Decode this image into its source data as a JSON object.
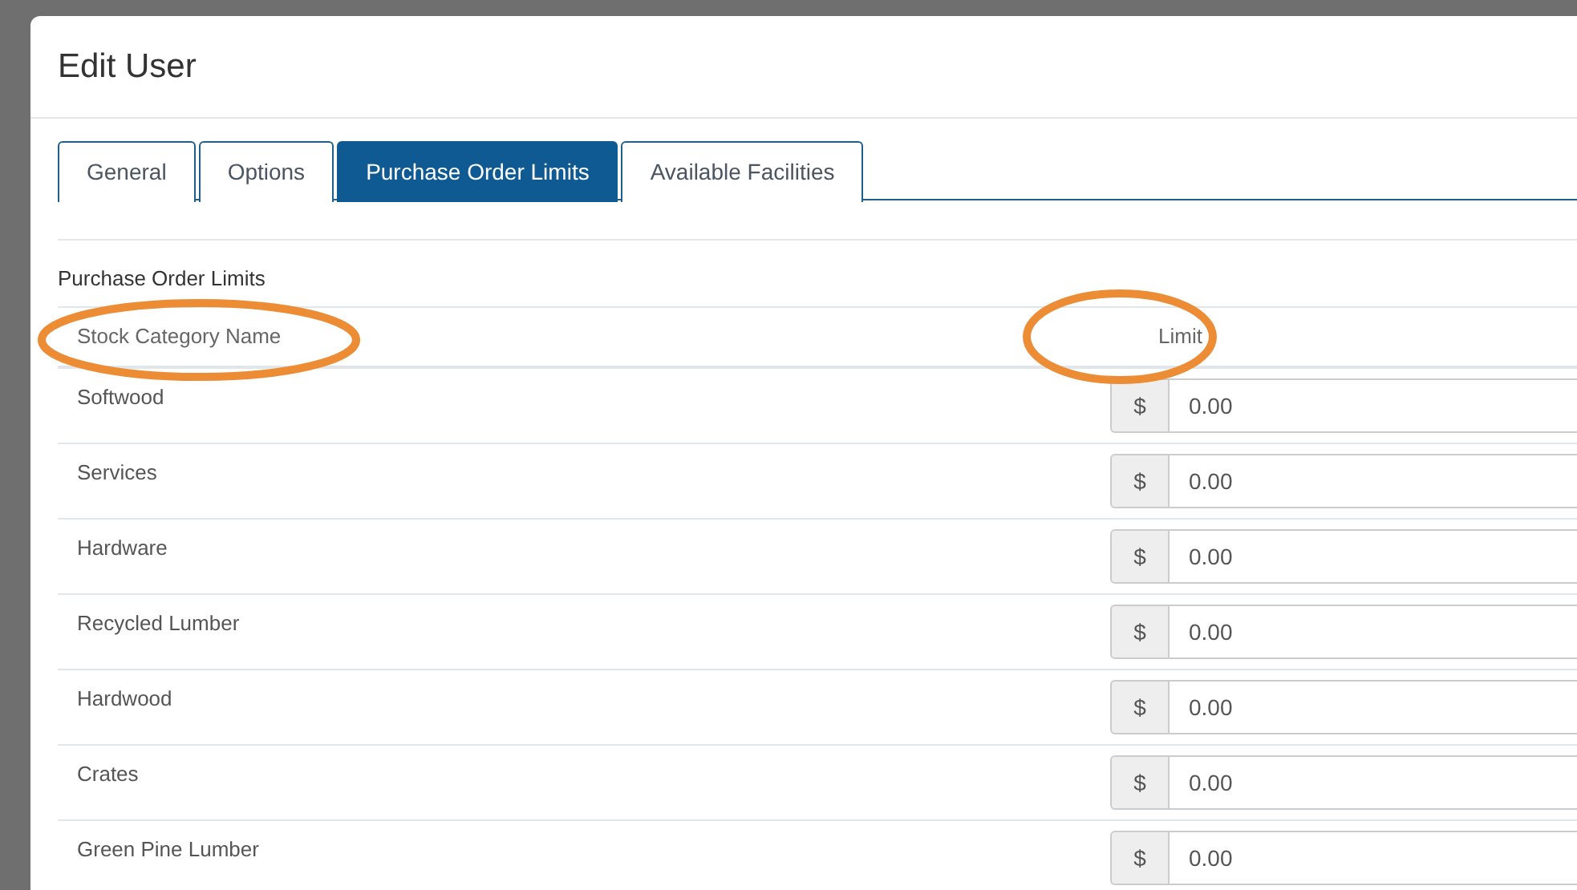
{
  "dialog": {
    "title": "Edit User"
  },
  "tabs": [
    {
      "label": "General",
      "selected": false
    },
    {
      "label": "Options",
      "selected": false
    },
    {
      "label": "Purchase Order Limits",
      "selected": true
    },
    {
      "label": "Available Facilities",
      "selected": false
    }
  ],
  "section_title": "Purchase Order Limits",
  "table": {
    "columns": [
      "Stock Category Name",
      "Limit"
    ],
    "rows": [
      {
        "name": "Softwood",
        "currency": "$",
        "limit": "0.00"
      },
      {
        "name": "Services",
        "currency": "$",
        "limit": "0.00"
      },
      {
        "name": "Hardware",
        "currency": "$",
        "limit": "0.00"
      },
      {
        "name": "Recycled Lumber",
        "currency": "$",
        "limit": "0.00"
      },
      {
        "name": "Hardwood",
        "currency": "$",
        "limit": "0.00"
      },
      {
        "name": "Crates",
        "currency": "$",
        "limit": "0.00"
      },
      {
        "name": "Green Pine Lumber",
        "currency": "$",
        "limit": "0.00"
      }
    ]
  }
}
